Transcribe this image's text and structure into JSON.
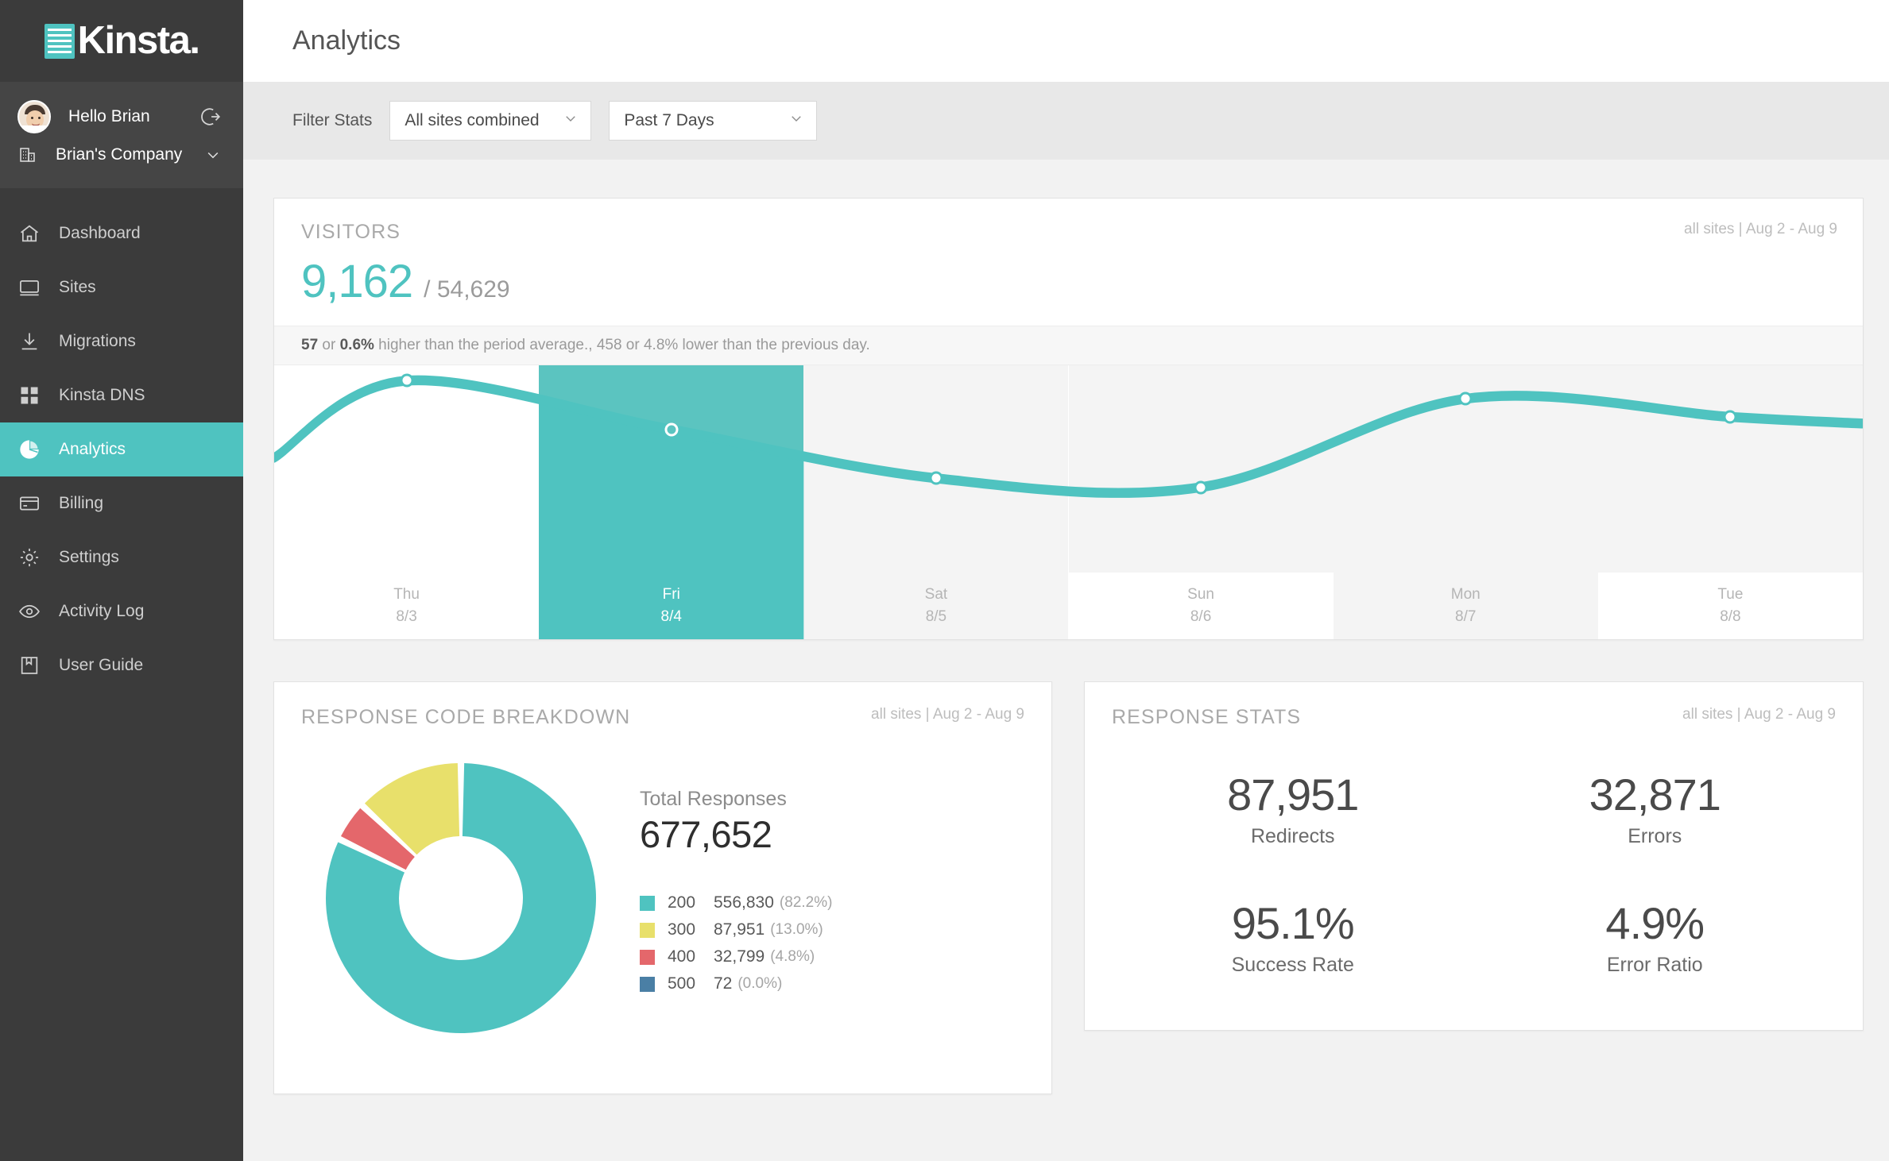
{
  "brand": {
    "name": "Kinsta.",
    "logo_icon": "kinsta-server-logo",
    "accent": "#4fc3c0"
  },
  "sidebar": {
    "greeting": "Hello Brian",
    "logout_icon": "logout-icon",
    "avatar_icon": "user-avatar",
    "company": "Brian's Company",
    "company_icon": "building-icon",
    "company_chevron": "chevron-down-icon",
    "items": [
      {
        "label": "Dashboard",
        "icon": "home-icon",
        "active": false
      },
      {
        "label": "Sites",
        "icon": "monitor-icon",
        "active": false
      },
      {
        "label": "Migrations",
        "icon": "download-icon",
        "active": false
      },
      {
        "label": "Kinsta DNS",
        "icon": "grid-icon",
        "active": false
      },
      {
        "label": "Analytics",
        "icon": "pie-chart-icon",
        "active": true
      },
      {
        "label": "Billing",
        "icon": "credit-card-icon",
        "active": false
      },
      {
        "label": "Settings",
        "icon": "gear-icon",
        "active": false
      },
      {
        "label": "Activity Log",
        "icon": "eye-icon",
        "active": false
      },
      {
        "label": "User Guide",
        "icon": "book-icon",
        "active": false
      }
    ]
  },
  "header": {
    "title": "Analytics"
  },
  "filter": {
    "label": "Filter Stats",
    "site_select": {
      "value": "All sites combined",
      "chevron": "chevron-down-icon"
    },
    "range_select": {
      "value": "Past 7 Days",
      "chevron": "chevron-down-icon"
    }
  },
  "visitors": {
    "title": "VISITORS",
    "meta": "all sites | Aug 2 - Aug 9",
    "value": "9,162",
    "total": "/ 54,629",
    "note_a": "57",
    "note_b": " or ",
    "note_c": "0.6%",
    "note_d": " higher than the period average., 458 or 4.8% lower than the previous day."
  },
  "chart_data": {
    "type": "area",
    "title": "VISITORS",
    "categories": [
      "Thu",
      "Fri",
      "Sat",
      "Sun",
      "Mon",
      "Tue"
    ],
    "tick_labels": [
      "8/3",
      "8/4",
      "8/5",
      "8/6",
      "8/7",
      "8/8"
    ],
    "values": [
      9620,
      9162,
      8704,
      8620,
      9450,
      9280
    ],
    "highlighted_index": 1,
    "highlighted_label": "Fri 8/4",
    "selected_value": "9,162",
    "series": [
      {
        "name": "Visitors",
        "values": [
          9620,
          9162,
          8704,
          8620,
          9450,
          9280
        ]
      }
    ],
    "ylim": [
      0,
      10500
    ],
    "xlabel": "",
    "ylabel": "",
    "grid": false,
    "legend": "none",
    "line_color": "#4fc3c0",
    "marker_fill": "#ffffff",
    "marker_stroke": "#4fc3c0"
  },
  "response_code_breakdown": {
    "title": "RESPONSE CODE BREAKDOWN",
    "meta": "all sites | Aug 2 - Aug 9",
    "total_label": "Total Responses",
    "total_value": "677,652",
    "legend": [
      {
        "code": "200",
        "value": "556,830",
        "pct": "(82.2%)",
        "pct_num": 82.2,
        "color": "#4fc3c0"
      },
      {
        "code": "300",
        "value": "87,951",
        "pct": "(13.0%)",
        "pct_num": 13.0,
        "color": "#e8e06b"
      },
      {
        "code": "400",
        "value": "32,799",
        "pct": "(4.8%)",
        "pct_num": 4.8,
        "color": "#e4676b"
      },
      {
        "code": "500",
        "value": "72",
        "pct": "(0.0%)",
        "pct_num": 0.0,
        "color": "#4a7fa5"
      }
    ]
  },
  "response_stats": {
    "title": "RESPONSE STATS",
    "meta": "all sites | Aug 2 - Aug 9",
    "items": [
      {
        "value": "87,951",
        "label": "Redirects"
      },
      {
        "value": "32,871",
        "label": "Errors"
      },
      {
        "value": "95.1%",
        "label": "Success Rate"
      },
      {
        "value": "4.9%",
        "label": "Error Ratio"
      }
    ]
  }
}
